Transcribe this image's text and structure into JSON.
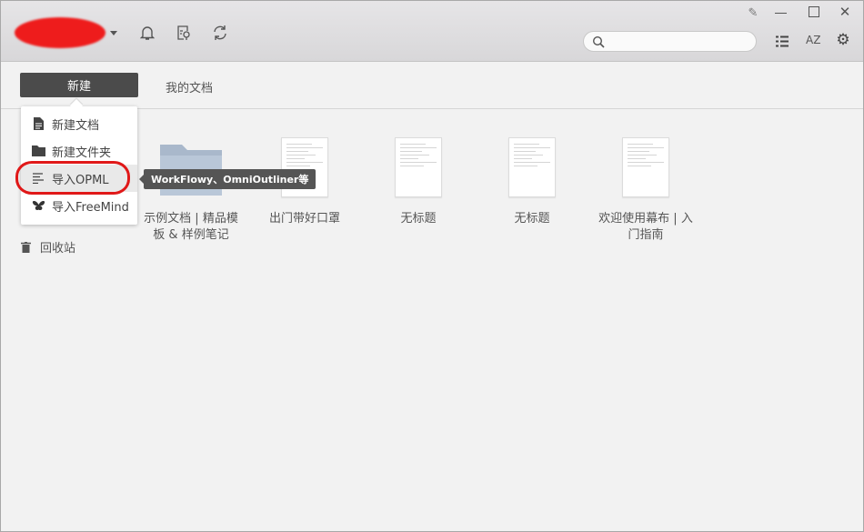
{
  "window": {
    "controls": [
      "pin-icon",
      "minimize-icon",
      "maximize-icon",
      "close-icon"
    ]
  },
  "header": {
    "icons": [
      "bell-icon",
      "doc-review-icon",
      "sync-icon"
    ],
    "search": {
      "placeholder": "",
      "value": ""
    },
    "right_icons": [
      "list-icon",
      "sort-az-icon",
      "gear-icon"
    ],
    "sort_label": "AZ"
  },
  "tabs": {
    "new": "新建",
    "my_docs": "我的文档"
  },
  "menu": {
    "items": [
      {
        "label": "新建文档",
        "icon": "document-icon"
      },
      {
        "label": "新建文件夹",
        "icon": "folder-icon"
      },
      {
        "label": "导入OPML",
        "icon": "outline-icon"
      },
      {
        "label": "导入FreeMind",
        "icon": "butterfly-icon"
      }
    ]
  },
  "tooltip": "WorkFlowy、OmniOutliner等",
  "trash": "回收站",
  "files": [
    {
      "type": "folder",
      "name": "示例文档 | 精品模板 & 样例笔记"
    },
    {
      "type": "doc",
      "name": "出门带好口罩"
    },
    {
      "type": "doc",
      "name": "无标题"
    },
    {
      "type": "doc",
      "name": "无标题"
    },
    {
      "type": "doc",
      "name": "欢迎使用幕布 | 入门指南"
    }
  ],
  "colors": {
    "button": "#4b4b4b",
    "highlight_ring": "#e01818"
  }
}
